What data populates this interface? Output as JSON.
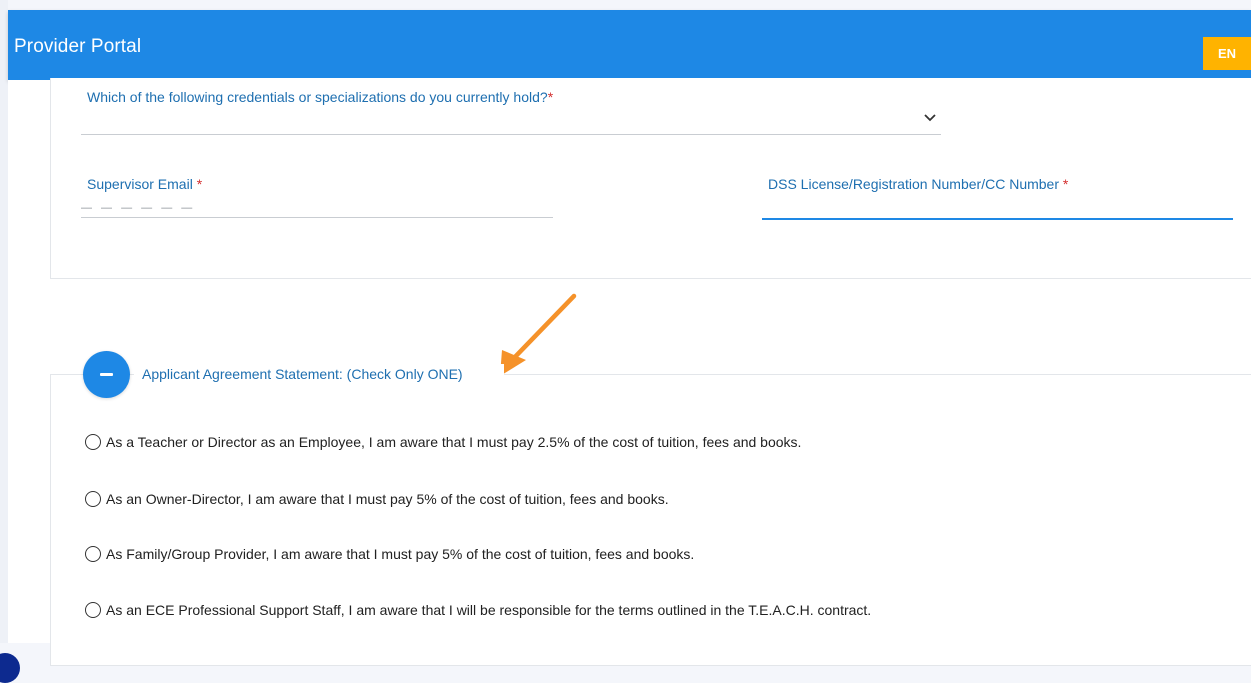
{
  "app": {
    "title": "Provider Portal",
    "language": "EN"
  },
  "form": {
    "credentials": {
      "label": "Which of the following credentials or specializations do you currently hold?",
      "required_mark": "*",
      "value": ""
    },
    "supervisor_email": {
      "label": "Supervisor Email",
      "required_mark": "*",
      "value": "— — — — — —"
    },
    "dss_license": {
      "label": "DSS License/Registration Number/CC Number",
      "required_mark": "*",
      "value": ""
    }
  },
  "agreement": {
    "title": "Applicant Agreement Statement: (Check Only ONE)",
    "options": [
      "As a Teacher or Director as an Employee, I am aware that I must pay 2.5% of the cost of tuition, fees and books.",
      "As an Owner-Director, I am aware that I must pay 5% of the cost of tuition, fees and books.",
      "As Family/Group Provider, I am aware that I must pay 5% of the cost of tuition, fees and books.",
      "As an ECE Professional Support Staff, I am aware that I will be responsible for the terms outlined in the T.E.A.C.H. contract."
    ]
  },
  "colors": {
    "header": "#1e88e5",
    "language_button": "#ffb300",
    "label": "#1e6fb0",
    "required": "#d32f2f",
    "annotation_arrow": "#f5922a"
  }
}
